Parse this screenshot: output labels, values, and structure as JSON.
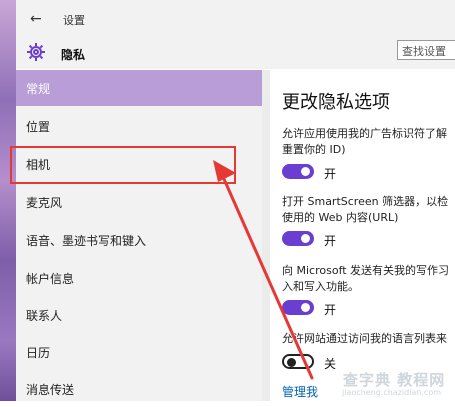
{
  "window": {
    "back_glyph": "←",
    "title": "设置"
  },
  "header": {
    "icon": "gear-icon",
    "section": "隐私",
    "search_placeholder": "查找设置"
  },
  "sidebar": {
    "items": [
      {
        "label": "常规",
        "active": true
      },
      {
        "label": "位置"
      },
      {
        "label": "相机"
      },
      {
        "label": "麦克风"
      },
      {
        "label": "语音、墨迹书写和键入"
      },
      {
        "label": "帐户信息"
      },
      {
        "label": "联系人"
      },
      {
        "label": "日历"
      },
      {
        "label": "消息传送"
      }
    ]
  },
  "main": {
    "title": "更改隐私选项",
    "settings": [
      {
        "desc_line1": "允许应用使用我的广告标识符了解",
        "desc_line2": "重置你的 ID)",
        "state": "开",
        "on": true
      },
      {
        "desc_line1": "打开 SmartScreen 筛选器，以检",
        "desc_line2": "使用的 Web 内容(URL)",
        "state": "开",
        "on": true
      },
      {
        "desc_line1": "向 Microsoft 发送有关我的写作习",
        "desc_line2": "入和写入功能。",
        "state": "开",
        "on": true
      },
      {
        "desc_line1": "允许网站通过访问我的语言列表来",
        "state": "关",
        "on": false
      }
    ],
    "link": "管理我"
  },
  "watermark": {
    "text": "查字典 教程网",
    "sub": "jiaocheng.chazidian.com"
  },
  "colors": {
    "accent": "#6a3ed0",
    "sidebar_active": "#b99dd6",
    "annotation": "#e53935"
  }
}
